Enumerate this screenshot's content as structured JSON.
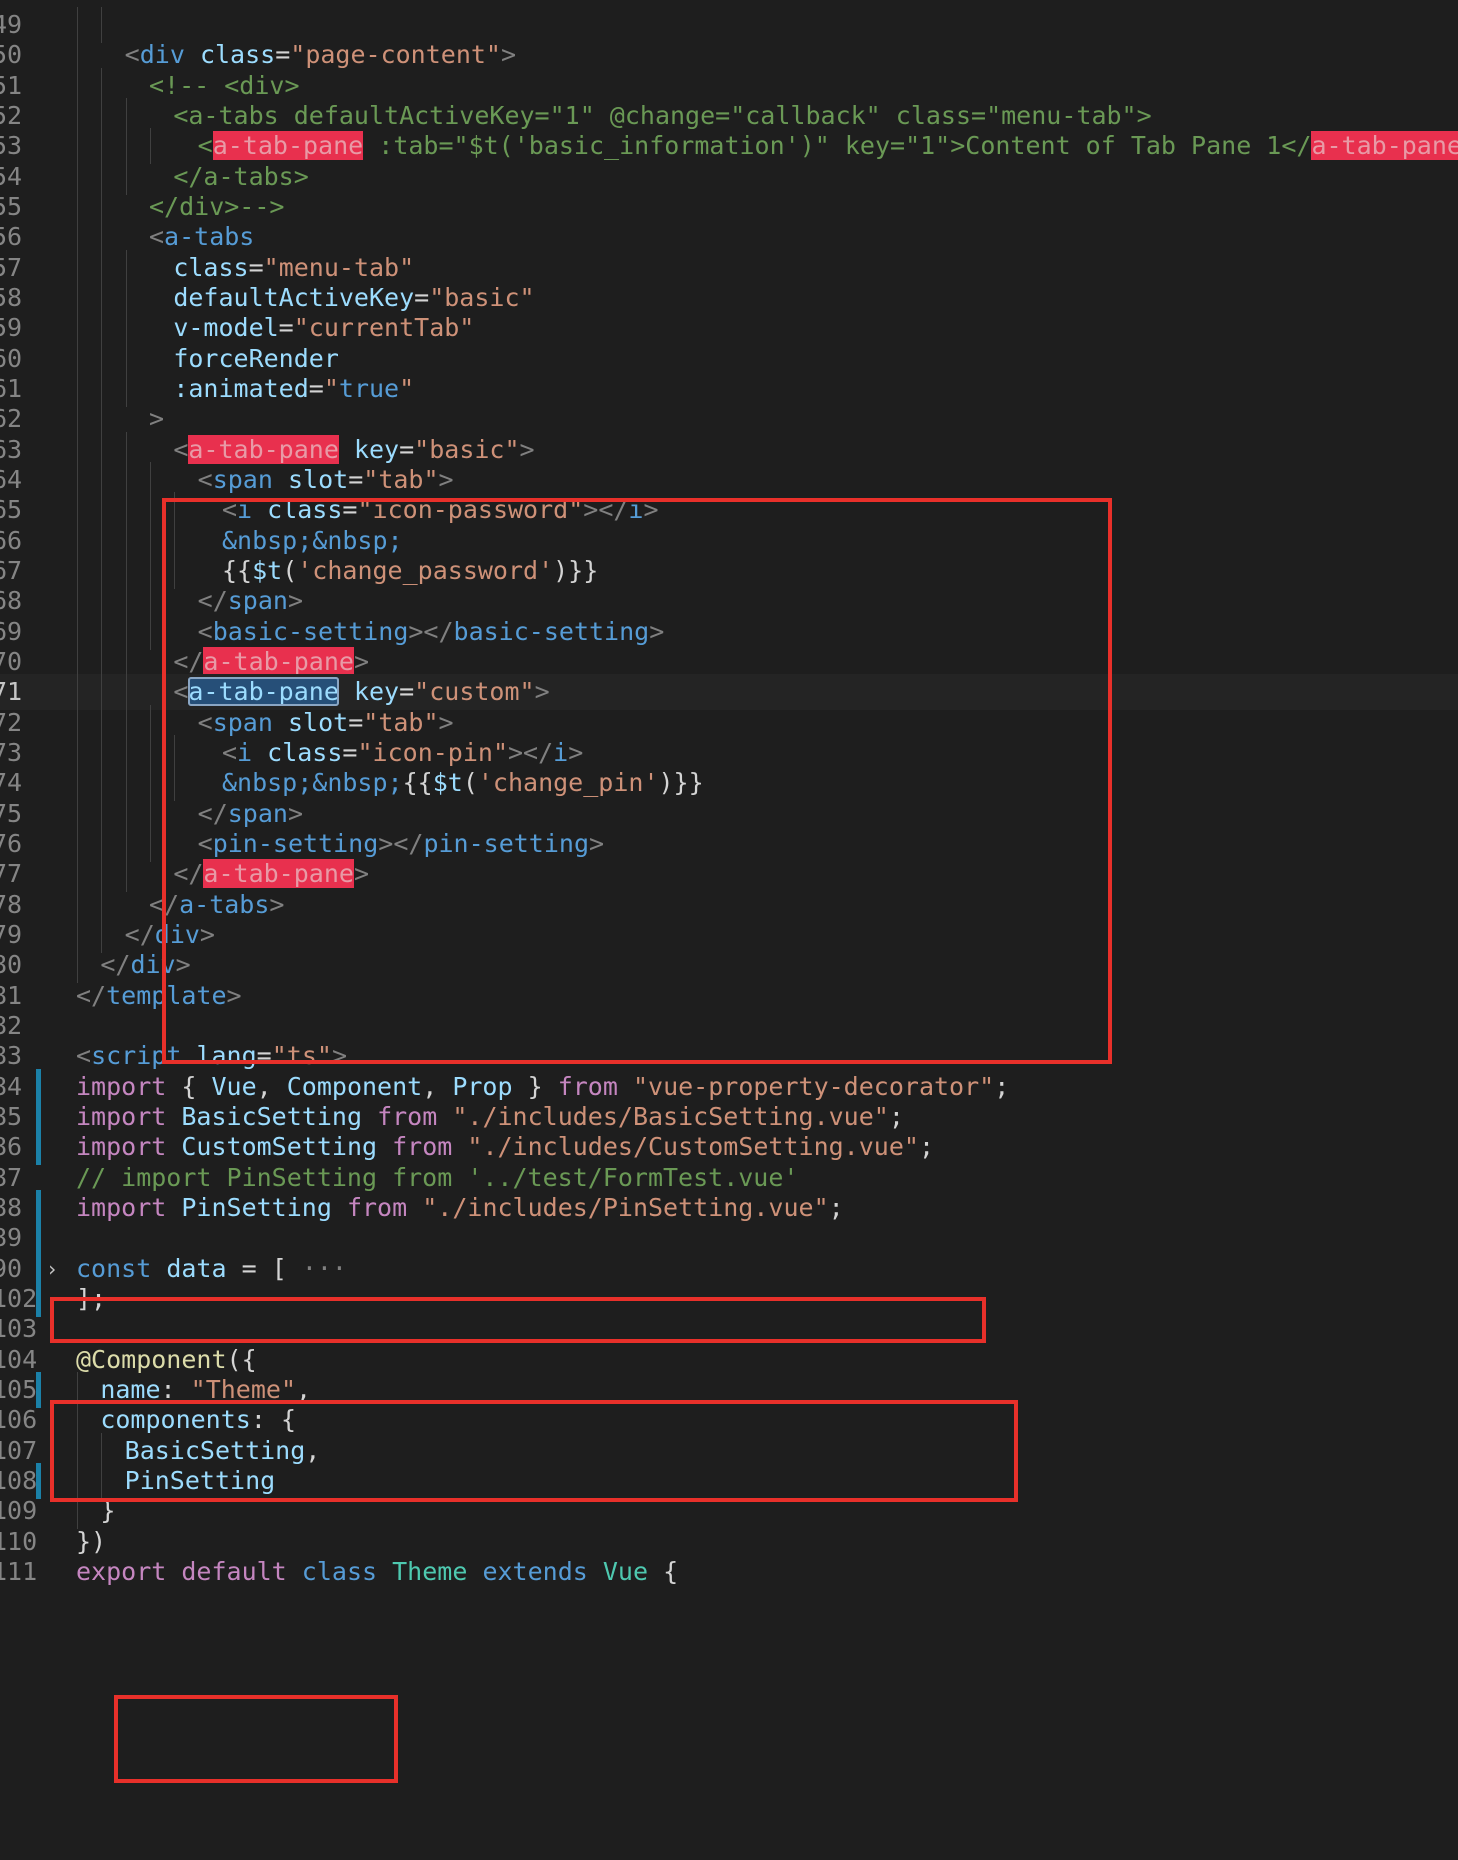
{
  "editor": {
    "lines": [
      {
        "n": "49",
        "tokens": []
      },
      {
        "n": "50",
        "tokens": [
          [
            "tag",
            "<"
          ],
          [
            "name",
            "div"
          ],
          [
            "tx",
            " "
          ],
          [
            "attr",
            "class"
          ],
          [
            "tx",
            "="
          ],
          [
            "str",
            "\"page-content\""
          ],
          [
            "tag",
            ">"
          ]
        ]
      },
      {
        "n": "51",
        "tokens": [
          [
            "cm",
            "<!-- <div>"
          ]
        ]
      },
      {
        "n": "52",
        "tokens": [
          [
            "cm",
            "<a-tabs defaultActiveKey=\"1\" @change=\"callback\" class=\"menu-tab\">"
          ]
        ]
      },
      {
        "n": "53",
        "tokens": [
          [
            "cm",
            "<"
          ],
          [
            "hl",
            "a-tab-pane"
          ],
          [
            "cm",
            " :tab=\"$t('basic_information')\" key=\"1\">Content of Tab Pane 1</"
          ],
          [
            "hl",
            "a-tab-pane"
          ],
          [
            "cm",
            ">"
          ]
        ]
      },
      {
        "n": "54",
        "tokens": [
          [
            "cm",
            "</a-tabs>"
          ]
        ]
      },
      {
        "n": "55",
        "tokens": [
          [
            "cm",
            "</div>-->"
          ]
        ]
      },
      {
        "n": "56",
        "tokens": [
          [
            "tag",
            "<"
          ],
          [
            "name",
            "a-tabs"
          ]
        ]
      },
      {
        "n": "57",
        "tokens": [
          [
            "attr",
            "class"
          ],
          [
            "tx",
            "="
          ],
          [
            "str",
            "\"menu-tab\""
          ]
        ]
      },
      {
        "n": "58",
        "tokens": [
          [
            "attr",
            "defaultActiveKey"
          ],
          [
            "tx",
            "="
          ],
          [
            "str",
            "\"basic\""
          ]
        ]
      },
      {
        "n": "59",
        "tokens": [
          [
            "attr",
            "v-model"
          ],
          [
            "tx",
            "="
          ],
          [
            "str",
            "\"currentTab\""
          ]
        ]
      },
      {
        "n": "60",
        "tokens": [
          [
            "attr",
            "forceRender"
          ]
        ]
      },
      {
        "n": "61",
        "tokens": [
          [
            "attr",
            ":animated"
          ],
          [
            "tx",
            "="
          ],
          [
            "str",
            "\""
          ],
          [
            "name",
            "true"
          ],
          [
            "str",
            "\""
          ]
        ]
      },
      {
        "n": "62",
        "tokens": [
          [
            "tag",
            ">"
          ]
        ]
      },
      {
        "n": "63",
        "tokens": [
          [
            "tag",
            "<"
          ],
          [
            "hl",
            "a-tab-pane"
          ],
          [
            "tx",
            " "
          ],
          [
            "attr",
            "key"
          ],
          [
            "tx",
            "="
          ],
          [
            "str",
            "\"basic\""
          ],
          [
            "tag",
            ">"
          ]
        ]
      },
      {
        "n": "64",
        "tokens": [
          [
            "tag",
            "<"
          ],
          [
            "name",
            "span"
          ],
          [
            "tx",
            " "
          ],
          [
            "attr",
            "slot"
          ],
          [
            "tx",
            "="
          ],
          [
            "str",
            "\"tab\""
          ],
          [
            "tag",
            ">"
          ]
        ]
      },
      {
        "n": "65",
        "tokens": [
          [
            "tag",
            "<"
          ],
          [
            "name",
            "i"
          ],
          [
            "tx",
            " "
          ],
          [
            "attr",
            "class"
          ],
          [
            "tx",
            "="
          ],
          [
            "str",
            "\"icon-password\""
          ],
          [
            "tag",
            "></"
          ],
          [
            "name",
            "i"
          ],
          [
            "tag",
            ">"
          ]
        ]
      },
      {
        "n": "66",
        "tokens": [
          [
            "name",
            "&nbsp;&nbsp;"
          ]
        ]
      },
      {
        "n": "67",
        "tokens": [
          [
            "tx",
            "{{"
          ],
          [
            "attr",
            "$t"
          ],
          [
            "tx",
            "("
          ],
          [
            "str",
            "'change_password'"
          ],
          [
            "tx",
            ")}}"
          ]
        ]
      },
      {
        "n": "68",
        "tokens": [
          [
            "tag",
            "</"
          ],
          [
            "name",
            "span"
          ],
          [
            "tag",
            ">"
          ]
        ]
      },
      {
        "n": "69",
        "tokens": [
          [
            "tag",
            "<"
          ],
          [
            "name",
            "basic-setting"
          ],
          [
            "tag",
            "></"
          ],
          [
            "name",
            "basic-setting"
          ],
          [
            "tag",
            ">"
          ]
        ]
      },
      {
        "n": "70",
        "tokens": [
          [
            "tag",
            "</"
          ],
          [
            "hl",
            "a-tab-pane"
          ],
          [
            "tag",
            ">"
          ]
        ]
      },
      {
        "n": "71",
        "tokens": [
          [
            "tag",
            "<"
          ],
          [
            "sel",
            "a-tab-pane"
          ],
          [
            "tx",
            " "
          ],
          [
            "attr",
            "key"
          ],
          [
            "tx",
            "="
          ],
          [
            "str",
            "\"custom\""
          ],
          [
            "tag",
            ">"
          ]
        ]
      },
      {
        "n": "72",
        "tokens": [
          [
            "tag",
            "<"
          ],
          [
            "name",
            "span"
          ],
          [
            "tx",
            " "
          ],
          [
            "attr",
            "slot"
          ],
          [
            "tx",
            "="
          ],
          [
            "str",
            "\"tab\""
          ],
          [
            "tag",
            ">"
          ]
        ]
      },
      {
        "n": "73",
        "tokens": [
          [
            "tag",
            "<"
          ],
          [
            "name",
            "i"
          ],
          [
            "tx",
            " "
          ],
          [
            "attr",
            "class"
          ],
          [
            "tx",
            "="
          ],
          [
            "str",
            "\"icon-pin\""
          ],
          [
            "tag",
            "></"
          ],
          [
            "name",
            "i"
          ],
          [
            "tag",
            ">"
          ]
        ]
      },
      {
        "n": "74",
        "tokens": [
          [
            "name",
            "&nbsp;&nbsp;"
          ],
          [
            "tx",
            "{{"
          ],
          [
            "attr",
            "$t"
          ],
          [
            "tx",
            "("
          ],
          [
            "str",
            "'change_pin'"
          ],
          [
            "tx",
            ")}}"
          ]
        ]
      },
      {
        "n": "75",
        "tokens": [
          [
            "tag",
            "</"
          ],
          [
            "name",
            "span"
          ],
          [
            "tag",
            ">"
          ]
        ]
      },
      {
        "n": "76",
        "tokens": [
          [
            "tag",
            "<"
          ],
          [
            "name",
            "pin-setting"
          ],
          [
            "tag",
            "></"
          ],
          [
            "name",
            "pin-setting"
          ],
          [
            "tag",
            ">"
          ]
        ]
      },
      {
        "n": "77",
        "tokens": [
          [
            "tag",
            "</"
          ],
          [
            "hl",
            "a-tab-pane"
          ],
          [
            "tag",
            ">"
          ]
        ]
      },
      {
        "n": "78",
        "tokens": [
          [
            "tag",
            "</"
          ],
          [
            "name",
            "a-tabs"
          ],
          [
            "tag",
            ">"
          ]
        ]
      },
      {
        "n": "79",
        "tokens": [
          [
            "tag",
            "</"
          ],
          [
            "name",
            "div"
          ],
          [
            "tag",
            ">"
          ]
        ]
      },
      {
        "n": "80",
        "tokens": [
          [
            "tag",
            "</"
          ],
          [
            "name",
            "div"
          ],
          [
            "tag",
            ">"
          ]
        ]
      },
      {
        "n": "81",
        "tokens": [
          [
            "tag",
            "</"
          ],
          [
            "name",
            "template"
          ],
          [
            "tag",
            ">"
          ]
        ]
      },
      {
        "n": "82",
        "tokens": []
      },
      {
        "n": "83",
        "tokens": [
          [
            "tag",
            "<"
          ],
          [
            "name",
            "script"
          ],
          [
            "tx",
            " "
          ],
          [
            "attr",
            "lang"
          ],
          [
            "tx",
            "="
          ],
          [
            "str",
            "\"ts\""
          ],
          [
            "tag",
            ">"
          ]
        ]
      },
      {
        "n": "84",
        "tokens": [
          [
            "kw",
            "import"
          ],
          [
            "tx",
            " { "
          ],
          [
            "attr",
            "Vue"
          ],
          [
            "tx",
            ", "
          ],
          [
            "attr",
            "Component"
          ],
          [
            "tx",
            ", "
          ],
          [
            "attr",
            "Prop"
          ],
          [
            "tx",
            " } "
          ],
          [
            "kw",
            "from"
          ],
          [
            "tx",
            " "
          ],
          [
            "str",
            "\"vue-property-decorator\""
          ],
          [
            "tx",
            ";"
          ]
        ]
      },
      {
        "n": "85",
        "tokens": [
          [
            "kw",
            "import"
          ],
          [
            "tx",
            " "
          ],
          [
            "attr",
            "BasicSetting"
          ],
          [
            "tx",
            " "
          ],
          [
            "kw",
            "from"
          ],
          [
            "tx",
            " "
          ],
          [
            "str",
            "\"./includes/BasicSetting.vue\""
          ],
          [
            "tx",
            ";"
          ]
        ]
      },
      {
        "n": "86",
        "tokens": [
          [
            "kw",
            "import"
          ],
          [
            "tx",
            " "
          ],
          [
            "attr",
            "CustomSetting"
          ],
          [
            "tx",
            " "
          ],
          [
            "kw",
            "from"
          ],
          [
            "tx",
            " "
          ],
          [
            "str",
            "\"./includes/CustomSetting.vue\""
          ],
          [
            "tx",
            ";"
          ]
        ]
      },
      {
        "n": "87",
        "tokens": [
          [
            "cm",
            "// import PinSetting from '../test/FormTest.vue'"
          ]
        ]
      },
      {
        "n": "88",
        "tokens": [
          [
            "kw",
            "import"
          ],
          [
            "tx",
            " "
          ],
          [
            "attr",
            "PinSetting"
          ],
          [
            "tx",
            " "
          ],
          [
            "kw",
            "from"
          ],
          [
            "tx",
            " "
          ],
          [
            "str",
            "\"./includes/PinSetting.vue\""
          ],
          [
            "tx",
            ";"
          ]
        ]
      },
      {
        "n": "89",
        "tokens": []
      },
      {
        "n": "90",
        "tokens": [
          [
            "name",
            "const"
          ],
          [
            "tx",
            " "
          ],
          [
            "attr",
            "data"
          ],
          [
            "tx",
            " = [ "
          ],
          [
            "tag",
            "···"
          ]
        ]
      },
      {
        "n": "102",
        "tokens": [
          [
            "tx",
            "];"
          ]
        ]
      },
      {
        "n": "103",
        "tokens": []
      },
      {
        "n": "104",
        "tokens": [
          [
            "fn",
            "@Component"
          ],
          [
            "tx",
            "({"
          ]
        ]
      },
      {
        "n": "105",
        "tokens": [
          [
            "attr",
            "name"
          ],
          [
            "tx",
            ": "
          ],
          [
            "str",
            "\"Theme\""
          ],
          [
            "tx",
            ","
          ]
        ]
      },
      {
        "n": "106",
        "tokens": [
          [
            "attr",
            "components"
          ],
          [
            "tx",
            ": {"
          ]
        ]
      },
      {
        "n": "107",
        "tokens": [
          [
            "attr",
            "BasicSetting"
          ],
          [
            "tx",
            ","
          ]
        ]
      },
      {
        "n": "108",
        "tokens": [
          [
            "attr",
            "PinSetting"
          ]
        ]
      },
      {
        "n": "109",
        "tokens": [
          [
            "tx",
            "}"
          ]
        ]
      },
      {
        "n": "110",
        "tokens": [
          [
            "tx",
            "})"
          ]
        ]
      },
      {
        "n": "111",
        "tokens": [
          [
            "kw",
            "export"
          ],
          [
            "tx",
            " "
          ],
          [
            "kw",
            "default"
          ],
          [
            "tx",
            " "
          ],
          [
            "name",
            "class"
          ],
          [
            "tx",
            " "
          ],
          [
            "cls",
            "Theme"
          ],
          [
            "tx",
            " "
          ],
          [
            "name",
            "extends"
          ],
          [
            "tx",
            " "
          ],
          [
            "cls",
            "Vue"
          ],
          [
            "tx",
            " {"
          ]
        ]
      }
    ],
    "current_line": "71",
    "fold_line": "90",
    "fold_icon": "chevron-right-icon",
    "modified_lines": [
      "84",
      "85",
      "86",
      "88",
      "89",
      "90",
      "102",
      "105",
      "108"
    ],
    "colors": {
      "background": "#1e1e1e",
      "annotation_red": "#e8302a",
      "highlight": "#e8304e",
      "git_modified": "#1b81a8"
    }
  }
}
